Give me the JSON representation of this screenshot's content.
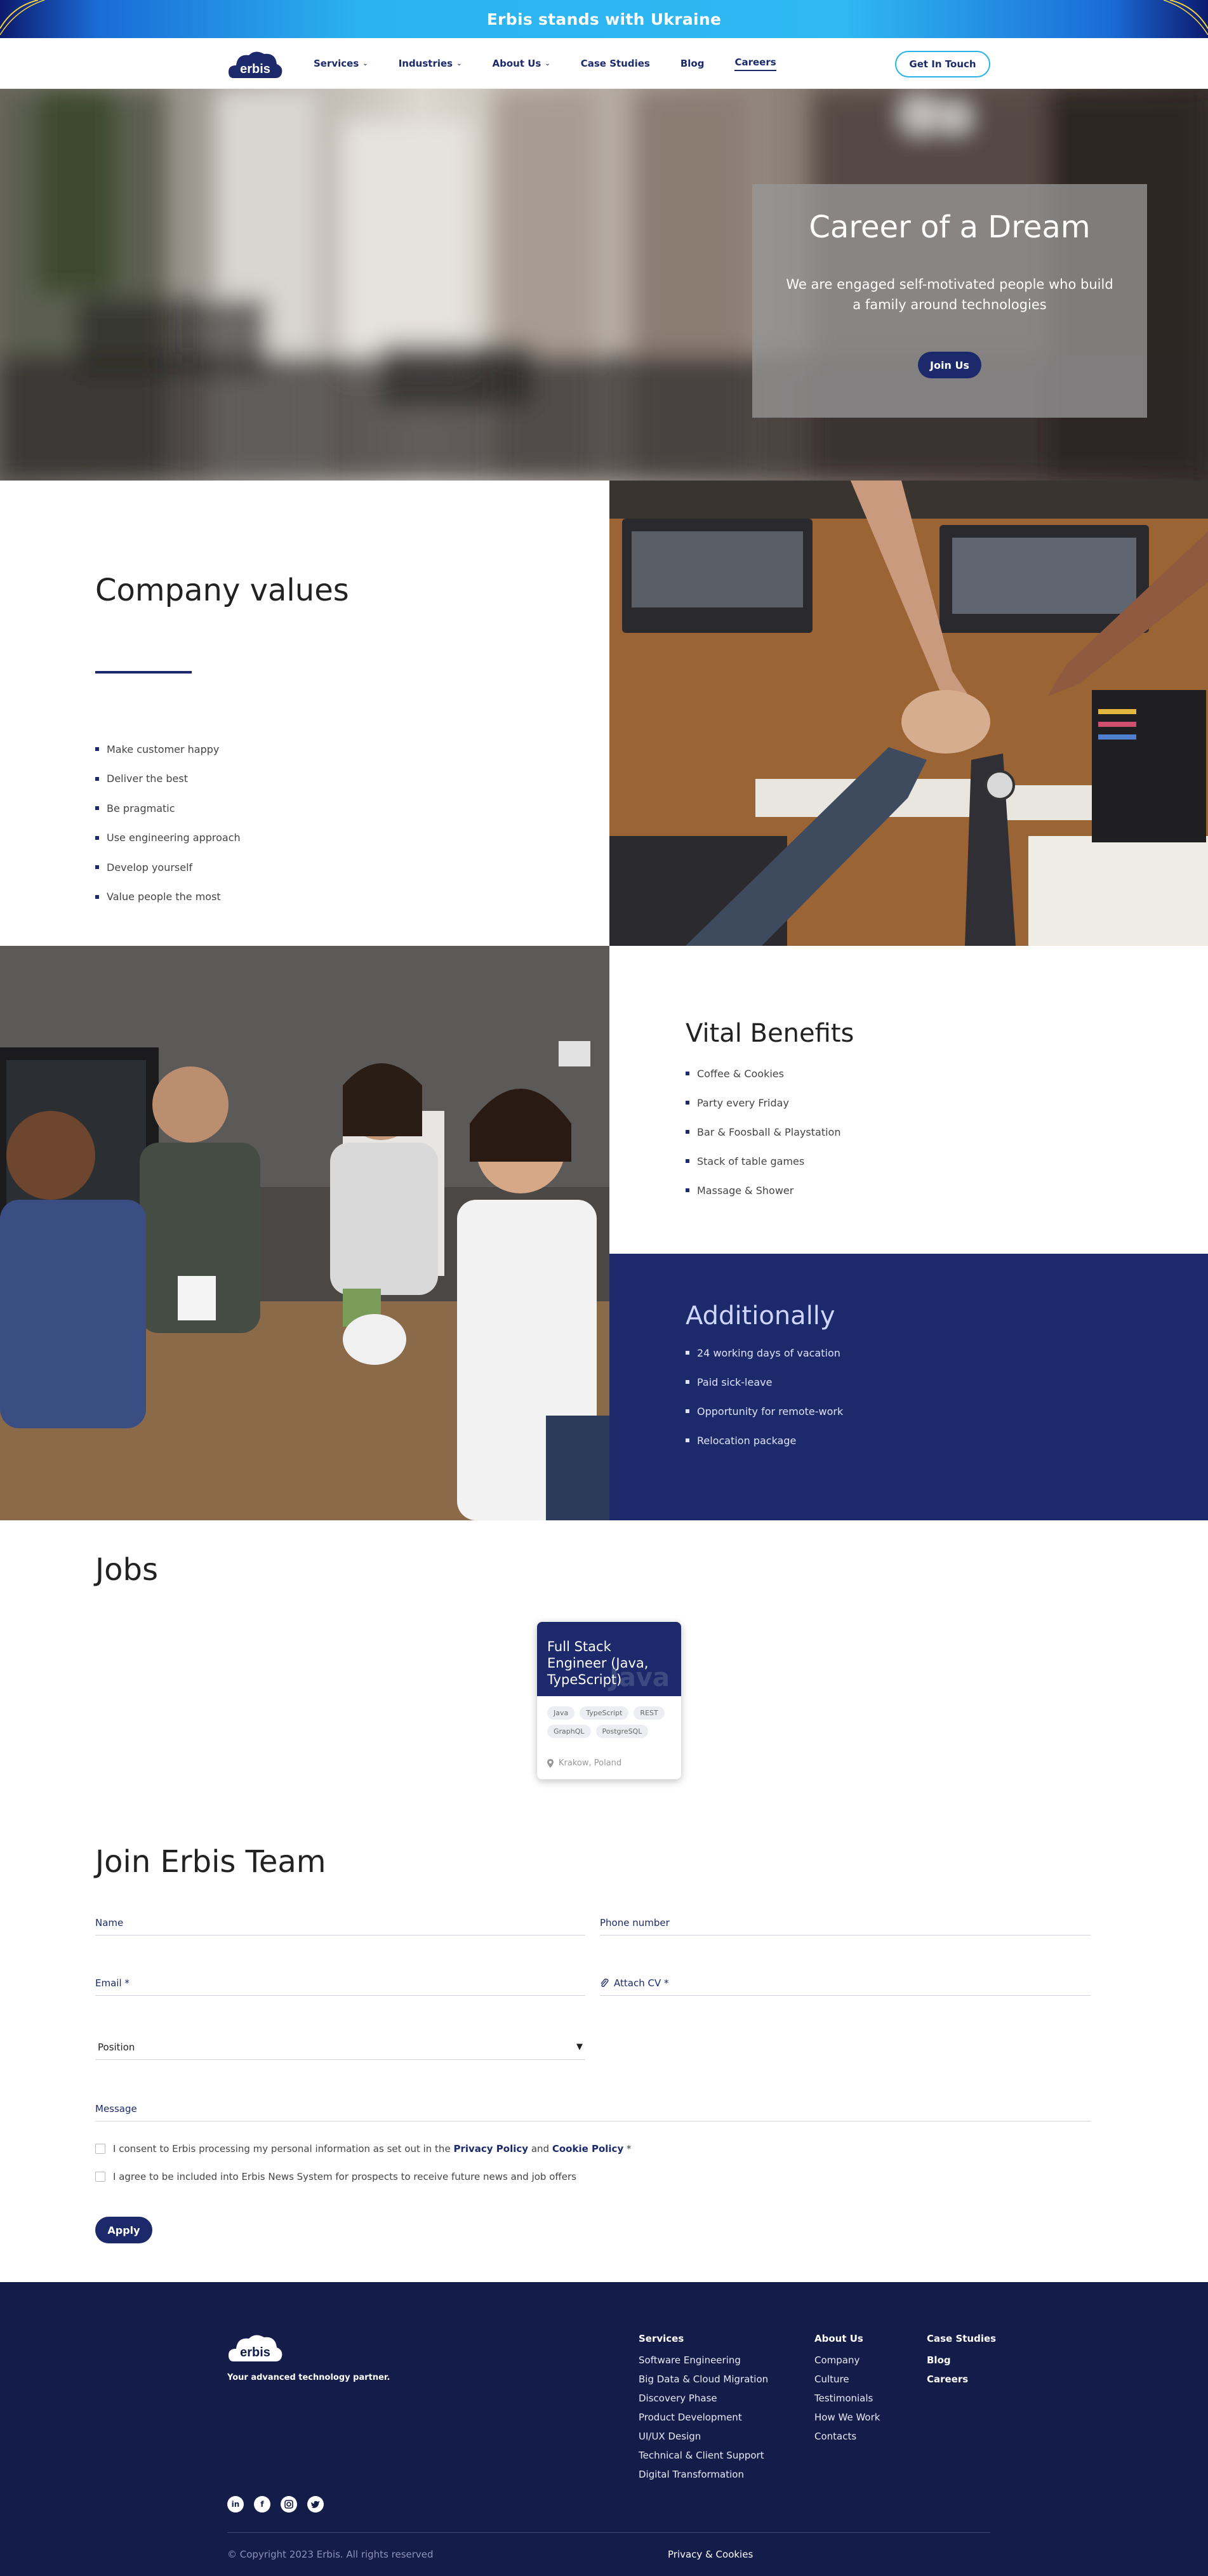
{
  "banner": {
    "text": "Erbis stands with Ukraine"
  },
  "header": {
    "logo_text": "erbis",
    "nav": [
      {
        "label": "Services",
        "has_dropdown": true
      },
      {
        "label": "Industries",
        "has_dropdown": true
      },
      {
        "label": "About Us",
        "has_dropdown": true
      },
      {
        "label": "Case Studies",
        "has_dropdown": false
      },
      {
        "label": "Blog",
        "has_dropdown": false
      },
      {
        "label": "Careers",
        "has_dropdown": false,
        "active": true
      }
    ],
    "cta": "Get In Touch"
  },
  "hero": {
    "title": "Career of a Dream",
    "subtitle": "We are engaged self-motivated people who build a family around technologies",
    "button": "Join Us"
  },
  "values": {
    "title": "Company values",
    "items": [
      "Make customer happy",
      "Deliver the best",
      "Be pragmatic",
      "Use engineering approach",
      "Develop yourself",
      "Value people the most"
    ]
  },
  "benefits": {
    "vital_title": "Vital Benefits",
    "vital_items": [
      "Coffee & Cookies",
      "Party every Friday",
      "Bar & Foosball & Playstation",
      "Stack of table games",
      "Massage & Shower"
    ],
    "additional_title": "Additionally",
    "additional_items": [
      "24 working days of vacation",
      "Paid sick-leave",
      "Opportunity for remote-work",
      "Relocation package"
    ]
  },
  "jobs": {
    "title": "Jobs",
    "cards": [
      {
        "title": "Full Stack Engineer (Java, TypeScript)",
        "watermark": "Java",
        "tags": [
          "Java",
          "TypeScript",
          "REST",
          "GraphQL",
          "PostgreSQL"
        ],
        "location": "Krakow, Poland"
      }
    ]
  },
  "join": {
    "title": "Join Erbis Team",
    "name_label": "Name",
    "phone_label": "Phone number",
    "email_label": "Email *",
    "cv_label": "Attach CV *",
    "position_label": "Position",
    "message_label": "Message",
    "consent_prefix": "I consent to Erbis processing my personal information as set out in the",
    "consent_privacy": "Privacy Policy",
    "consent_and": "and",
    "consent_cookie": "Cookie Policy",
    "consent_suffix": "*",
    "news_consent": "I agree to be included into Erbis News System for prospects to receive future news and job offers",
    "apply": "Apply"
  },
  "footer": {
    "logo_text": "erbis",
    "tagline": "Your advanced technology partner.",
    "services_head": "Services",
    "services": [
      "Software Engineering",
      "Big Data & Cloud Migration",
      "Discovery Phase",
      "Product Development",
      "UI/UX Design",
      "Technical & Client Support",
      "Digital Transformation"
    ],
    "about_head": "About Us",
    "about": [
      "Company",
      "Culture",
      "Testimonials",
      "How We Work",
      "Contacts"
    ],
    "other_links": [
      "Case Studies",
      "Blog",
      "Careers"
    ],
    "socials": [
      "linkedin-icon",
      "facebook-icon",
      "instagram-icon",
      "twitter-icon"
    ],
    "copyright": "© Copyright 2023 Erbis. All rights reserved",
    "privacy": "Privacy & Cookies"
  },
  "colors": {
    "navy": "#1c2a6b",
    "footer_navy": "#141c4a",
    "accent_blue": "#29b3e9"
  }
}
